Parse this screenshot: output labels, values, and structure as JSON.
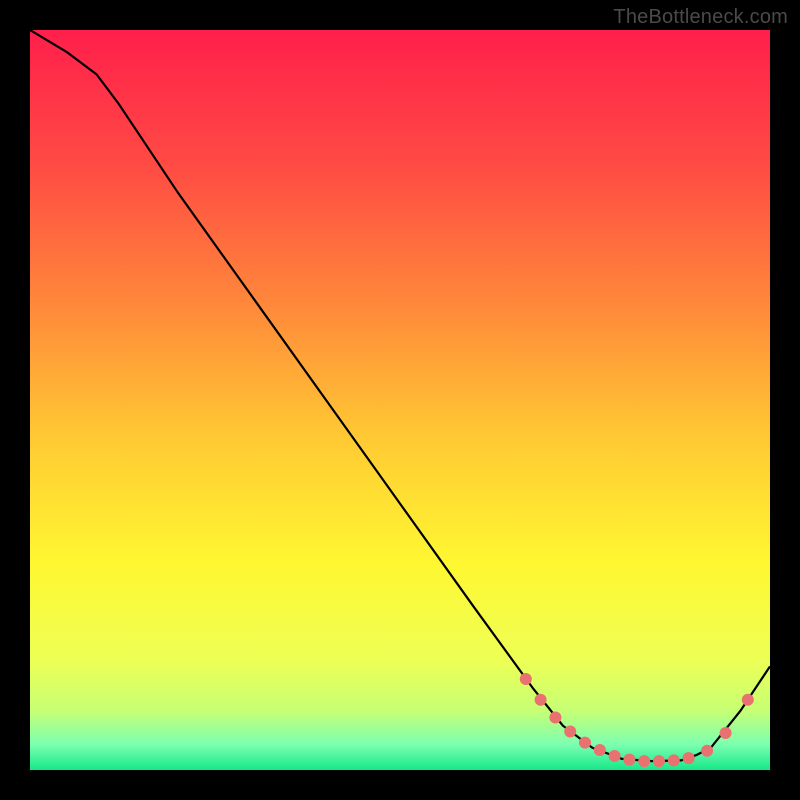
{
  "watermark": "TheBottleneck.com",
  "chart_data": {
    "type": "line",
    "title": "",
    "xlabel": "",
    "ylabel": "",
    "xlim": [
      0,
      100
    ],
    "ylim": [
      0,
      100
    ],
    "series": [
      {
        "name": "curve",
        "x": [
          0,
          5,
          9,
          12,
          20,
          30,
          40,
          50,
          60,
          68,
          72,
          76,
          80,
          84,
          88,
          90,
          92,
          96,
          100
        ],
        "y": [
          100,
          97,
          94,
          90,
          78,
          64,
          50,
          36,
          22,
          11,
          6,
          3,
          1.5,
          1.2,
          1.3,
          2,
          3,
          8,
          14
        ]
      }
    ],
    "markers": {
      "name": "highlight",
      "x": [
        67,
        69,
        71,
        73,
        75,
        77,
        79,
        81,
        83,
        85,
        87,
        89,
        91.5,
        94,
        97
      ],
      "y": [
        12.3,
        9.5,
        7.1,
        5.2,
        3.7,
        2.7,
        1.9,
        1.4,
        1.2,
        1.2,
        1.3,
        1.6,
        2.6,
        5.0,
        9.5
      ]
    },
    "gradient_stops": [
      {
        "offset": 0.0,
        "color": "#ff1f4b"
      },
      {
        "offset": 0.18,
        "color": "#ff4a44"
      },
      {
        "offset": 0.38,
        "color": "#ff8b3a"
      },
      {
        "offset": 0.55,
        "color": "#ffc933"
      },
      {
        "offset": 0.72,
        "color": "#fff731"
      },
      {
        "offset": 0.85,
        "color": "#eeff55"
      },
      {
        "offset": 0.92,
        "color": "#c6ff74"
      },
      {
        "offset": 0.965,
        "color": "#7dffb0"
      },
      {
        "offset": 1.0,
        "color": "#17e88a"
      }
    ]
  }
}
